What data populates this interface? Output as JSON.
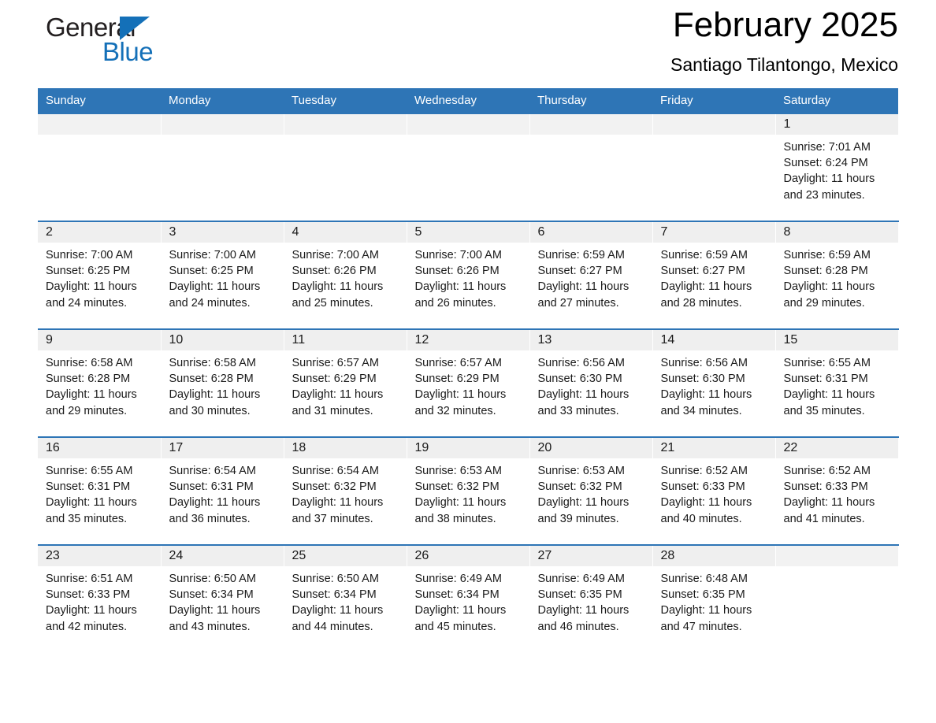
{
  "brand": {
    "name_part1": "General",
    "name_part2": "Blue",
    "triangle_icon": "triangle-logo-icon",
    "accent_color": "#1470b8"
  },
  "header": {
    "month_title": "February 2025",
    "location": "Santiago Tilantongo, Mexico"
  },
  "theme": {
    "header_band": "#2e75b6",
    "daynum_band": "#efefef",
    "text": "#1a1a1a"
  },
  "calendar": {
    "weekdays": [
      "Sunday",
      "Monday",
      "Tuesday",
      "Wednesday",
      "Thursday",
      "Friday",
      "Saturday"
    ],
    "weeks": [
      [
        {
          "day": "",
          "lines": []
        },
        {
          "day": "",
          "lines": []
        },
        {
          "day": "",
          "lines": []
        },
        {
          "day": "",
          "lines": []
        },
        {
          "day": "",
          "lines": []
        },
        {
          "day": "",
          "lines": []
        },
        {
          "day": "1",
          "lines": [
            "Sunrise: 7:01 AM",
            "Sunset: 6:24 PM",
            "Daylight: 11 hours and 23 minutes."
          ]
        }
      ],
      [
        {
          "day": "2",
          "lines": [
            "Sunrise: 7:00 AM",
            "Sunset: 6:25 PM",
            "Daylight: 11 hours and 24 minutes."
          ]
        },
        {
          "day": "3",
          "lines": [
            "Sunrise: 7:00 AM",
            "Sunset: 6:25 PM",
            "Daylight: 11 hours and 24 minutes."
          ]
        },
        {
          "day": "4",
          "lines": [
            "Sunrise: 7:00 AM",
            "Sunset: 6:26 PM",
            "Daylight: 11 hours and 25 minutes."
          ]
        },
        {
          "day": "5",
          "lines": [
            "Sunrise: 7:00 AM",
            "Sunset: 6:26 PM",
            "Daylight: 11 hours and 26 minutes."
          ]
        },
        {
          "day": "6",
          "lines": [
            "Sunrise: 6:59 AM",
            "Sunset: 6:27 PM",
            "Daylight: 11 hours and 27 minutes."
          ]
        },
        {
          "day": "7",
          "lines": [
            "Sunrise: 6:59 AM",
            "Sunset: 6:27 PM",
            "Daylight: 11 hours and 28 minutes."
          ]
        },
        {
          "day": "8",
          "lines": [
            "Sunrise: 6:59 AM",
            "Sunset: 6:28 PM",
            "Daylight: 11 hours and 29 minutes."
          ]
        }
      ],
      [
        {
          "day": "9",
          "lines": [
            "Sunrise: 6:58 AM",
            "Sunset: 6:28 PM",
            "Daylight: 11 hours and 29 minutes."
          ]
        },
        {
          "day": "10",
          "lines": [
            "Sunrise: 6:58 AM",
            "Sunset: 6:28 PM",
            "Daylight: 11 hours and 30 minutes."
          ]
        },
        {
          "day": "11",
          "lines": [
            "Sunrise: 6:57 AM",
            "Sunset: 6:29 PM",
            "Daylight: 11 hours and 31 minutes."
          ]
        },
        {
          "day": "12",
          "lines": [
            "Sunrise: 6:57 AM",
            "Sunset: 6:29 PM",
            "Daylight: 11 hours and 32 minutes."
          ]
        },
        {
          "day": "13",
          "lines": [
            "Sunrise: 6:56 AM",
            "Sunset: 6:30 PM",
            "Daylight: 11 hours and 33 minutes."
          ]
        },
        {
          "day": "14",
          "lines": [
            "Sunrise: 6:56 AM",
            "Sunset: 6:30 PM",
            "Daylight: 11 hours and 34 minutes."
          ]
        },
        {
          "day": "15",
          "lines": [
            "Sunrise: 6:55 AM",
            "Sunset: 6:31 PM",
            "Daylight: 11 hours and 35 minutes."
          ]
        }
      ],
      [
        {
          "day": "16",
          "lines": [
            "Sunrise: 6:55 AM",
            "Sunset: 6:31 PM",
            "Daylight: 11 hours and 35 minutes."
          ]
        },
        {
          "day": "17",
          "lines": [
            "Sunrise: 6:54 AM",
            "Sunset: 6:31 PM",
            "Daylight: 11 hours and 36 minutes."
          ]
        },
        {
          "day": "18",
          "lines": [
            "Sunrise: 6:54 AM",
            "Sunset: 6:32 PM",
            "Daylight: 11 hours and 37 minutes."
          ]
        },
        {
          "day": "19",
          "lines": [
            "Sunrise: 6:53 AM",
            "Sunset: 6:32 PM",
            "Daylight: 11 hours and 38 minutes."
          ]
        },
        {
          "day": "20",
          "lines": [
            "Sunrise: 6:53 AM",
            "Sunset: 6:32 PM",
            "Daylight: 11 hours and 39 minutes."
          ]
        },
        {
          "day": "21",
          "lines": [
            "Sunrise: 6:52 AM",
            "Sunset: 6:33 PM",
            "Daylight: 11 hours and 40 minutes."
          ]
        },
        {
          "day": "22",
          "lines": [
            "Sunrise: 6:52 AM",
            "Sunset: 6:33 PM",
            "Daylight: 11 hours and 41 minutes."
          ]
        }
      ],
      [
        {
          "day": "23",
          "lines": [
            "Sunrise: 6:51 AM",
            "Sunset: 6:33 PM",
            "Daylight: 11 hours and 42 minutes."
          ]
        },
        {
          "day": "24",
          "lines": [
            "Sunrise: 6:50 AM",
            "Sunset: 6:34 PM",
            "Daylight: 11 hours and 43 minutes."
          ]
        },
        {
          "day": "25",
          "lines": [
            "Sunrise: 6:50 AM",
            "Sunset: 6:34 PM",
            "Daylight: 11 hours and 44 minutes."
          ]
        },
        {
          "day": "26",
          "lines": [
            "Sunrise: 6:49 AM",
            "Sunset: 6:34 PM",
            "Daylight: 11 hours and 45 minutes."
          ]
        },
        {
          "day": "27",
          "lines": [
            "Sunrise: 6:49 AM",
            "Sunset: 6:35 PM",
            "Daylight: 11 hours and 46 minutes."
          ]
        },
        {
          "day": "28",
          "lines": [
            "Sunrise: 6:48 AM",
            "Sunset: 6:35 PM",
            "Daylight: 11 hours and 47 minutes."
          ]
        },
        {
          "day": "",
          "lines": []
        }
      ]
    ]
  }
}
